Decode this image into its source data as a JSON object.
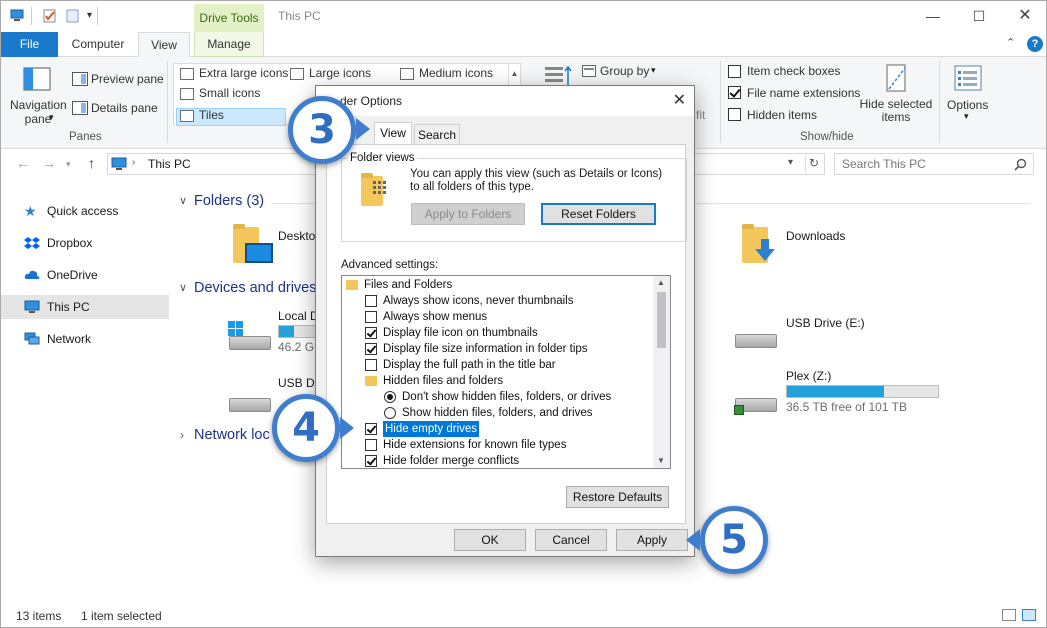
{
  "window": {
    "title": "This PC",
    "context_tab": "Drive Tools",
    "tabs": [
      "File",
      "Computer",
      "View",
      "Manage"
    ],
    "help": "?"
  },
  "ribbon": {
    "panes": {
      "navigation_pane": "Navigation pane",
      "preview_pane": "Preview pane",
      "details_pane": "Details pane",
      "group_label": "Panes"
    },
    "layout": {
      "items": [
        "Extra large icons",
        "Large icons",
        "Medium icons",
        "Small icons",
        "Tiles"
      ],
      "selected": "Tiles"
    },
    "current_view": {
      "group_by": "Group by",
      "partial_label": "fit"
    },
    "show_hide": {
      "item_check_boxes": "Item check boxes",
      "item_check_boxes_checked": false,
      "file_name_extensions": "File name extensions",
      "file_name_extensions_checked": true,
      "hidden_items": "Hidden items",
      "hidden_items_checked": false,
      "hide_selected_items": "Hide selected items",
      "group_label": "Show/hide"
    },
    "options": "Options"
  },
  "address": {
    "path": "This PC",
    "search_placeholder": "Search This PC"
  },
  "nav_pane": {
    "items": [
      "Quick access",
      "Dropbox",
      "OneDrive",
      "This PC",
      "Network"
    ],
    "selected": "This PC"
  },
  "content": {
    "folders_header": "Folders (3)",
    "folders": [
      "Deskto",
      "Downloads"
    ],
    "devices_header": "Devices and drives",
    "drives": [
      {
        "name": "Local D",
        "free": "46.2 GB",
        "fill": 0.4
      },
      {
        "name": "USB Dr"
      },
      {
        "name": "USB Drive (E:)"
      },
      {
        "name": "Plex (Z:)",
        "free": "36.5 TB free of 101 TB",
        "fill": 0.64
      }
    ],
    "network_header": "Network loc"
  },
  "status": {
    "count": "13 items",
    "selected": "1 item selected"
  },
  "dialog": {
    "title": "der Options",
    "tabs": [
      "View",
      "Search"
    ],
    "active_tab": "View",
    "folder_views": {
      "title": "Folder views",
      "description": "You can apply this view (such as Details or Icons) to all folders of this type.",
      "apply_to_folders": "Apply to Folders",
      "reset_folders": "Reset Folders"
    },
    "advanced_label": "Advanced settings:",
    "tree": [
      {
        "type": "folder",
        "label": "Files and Folders",
        "indent": 0
      },
      {
        "type": "check",
        "label": "Always show icons, never thumbnails",
        "checked": false,
        "indent": 1
      },
      {
        "type": "check",
        "label": "Always show menus",
        "checked": false,
        "indent": 1
      },
      {
        "type": "check",
        "label": "Display file icon on thumbnails",
        "checked": true,
        "indent": 1
      },
      {
        "type": "check",
        "label": "Display file size information in folder tips",
        "checked": true,
        "indent": 1
      },
      {
        "type": "check",
        "label": "Display the full path in the title bar",
        "checked": false,
        "indent": 1
      },
      {
        "type": "folder",
        "label": "Hidden files and folders",
        "indent": 1
      },
      {
        "type": "radio",
        "label": "Don't show hidden files, folders, or drives",
        "checked": true,
        "indent": 2
      },
      {
        "type": "radio",
        "label": "Show hidden files, folders, and drives",
        "checked": false,
        "indent": 2
      },
      {
        "type": "check",
        "label": "Hide empty drives",
        "checked": true,
        "indent": 1,
        "highlight": true
      },
      {
        "type": "check",
        "label": "Hide extensions for known file types",
        "checked": false,
        "indent": 1
      },
      {
        "type": "check",
        "label": "Hide folder merge conflicts",
        "checked": true,
        "indent": 1
      }
    ],
    "restore_defaults": "Restore Defaults",
    "ok": "OK",
    "cancel": "Cancel",
    "apply": "Apply"
  },
  "steps": [
    "3",
    "4",
    "5"
  ],
  "colors": {
    "accent": "#1979ca",
    "badge": "#3f7ecf",
    "highlight": "#0078d7"
  }
}
